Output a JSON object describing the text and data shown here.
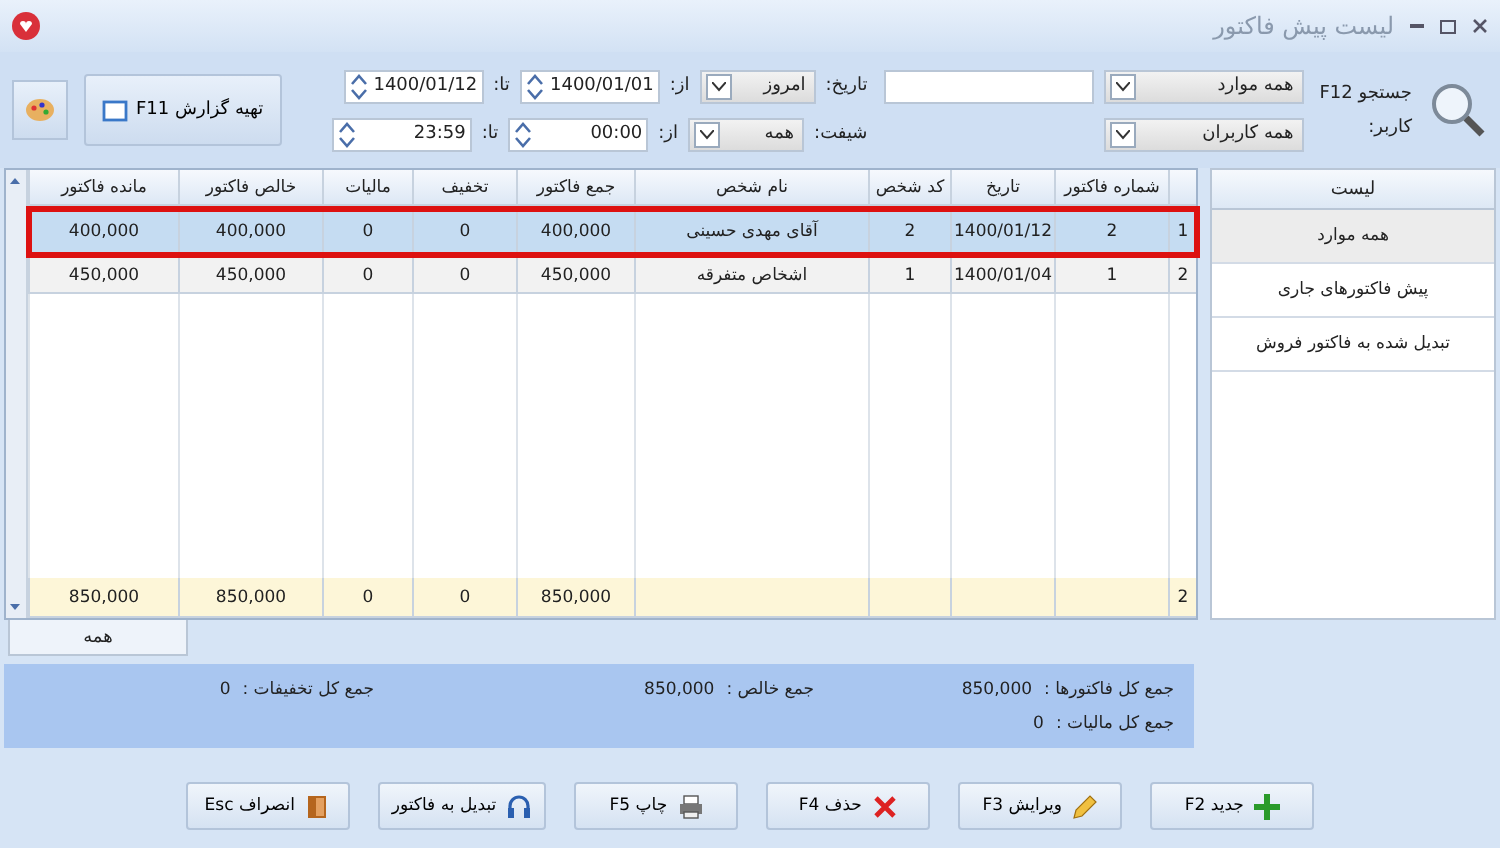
{
  "window": {
    "title": "لیست پیش فاکتور"
  },
  "toolbar": {
    "search_label": "جستجو F12",
    "search_scope": "همه موارد",
    "user_label": "کاربر:",
    "user": "همه کاربران",
    "date_label": "تاریخ:",
    "date_preset": "امروز",
    "from_label": "از:",
    "date_from": "1400/01/01",
    "to_label": "تا:",
    "date_to": "1400/01/12",
    "shift_label": "شیفت:",
    "shift": "همه",
    "time_from_label": "از:",
    "time_from": "00:00",
    "time_to_label": "تا:",
    "time_to": "23:59",
    "report_button": "تهیه گزارش F11"
  },
  "table": {
    "columns": [
      "",
      "شماره فاکتور",
      "تاریخ",
      "کد شخص",
      "نام شخص",
      "جمع فاکتور",
      "تخفیف",
      "مالیات",
      "خالص فاکتور",
      "مانده فاکتور"
    ],
    "rows": [
      {
        "selected": true,
        "cells": [
          "1",
          "2",
          "1400/01/12",
          "2",
          "آقای مهدی حسینی",
          "400,000",
          "0",
          "0",
          "400,000",
          "400,000"
        ]
      },
      {
        "selected": false,
        "cells": [
          "2",
          "1",
          "1400/01/04",
          "1",
          "اشخاص متفرقه",
          "450,000",
          "0",
          "0",
          "450,000",
          "450,000"
        ]
      }
    ],
    "footer": {
      "row_count": "2",
      "totals": [
        "850,000",
        "0",
        "0",
        "850,000",
        "850,000"
      ]
    }
  },
  "tabs": [
    {
      "label": "همه",
      "selected": true
    }
  ],
  "list_panel": {
    "title": "لیست",
    "items": [
      {
        "label": "همه موارد",
        "selected": true
      },
      {
        "label": "پیش فاکتورهای جاری",
        "selected": false
      },
      {
        "label": "تبدیل شده به فاکتور فروش",
        "selected": false
      }
    ]
  },
  "summary": [
    {
      "label": "جمع کل فاکتورها :",
      "value": "850,000"
    },
    {
      "label": "جمع خالص :",
      "value": "850,000"
    },
    {
      "label": "جمع کل تخفیفات :",
      "value": "0"
    },
    {
      "label": "جمع کل مالیات :",
      "value": "0"
    }
  ],
  "buttons": [
    {
      "kind": "new",
      "label": "جدید F2"
    },
    {
      "kind": "edit",
      "label": "ویرایش F3"
    },
    {
      "kind": "delete",
      "label": "حذف F4"
    },
    {
      "kind": "print",
      "label": "چاپ F5"
    },
    {
      "kind": "convert",
      "label": "تبدیل به فاکتور"
    },
    {
      "kind": "cancel",
      "label": "انصراف Esc"
    }
  ]
}
